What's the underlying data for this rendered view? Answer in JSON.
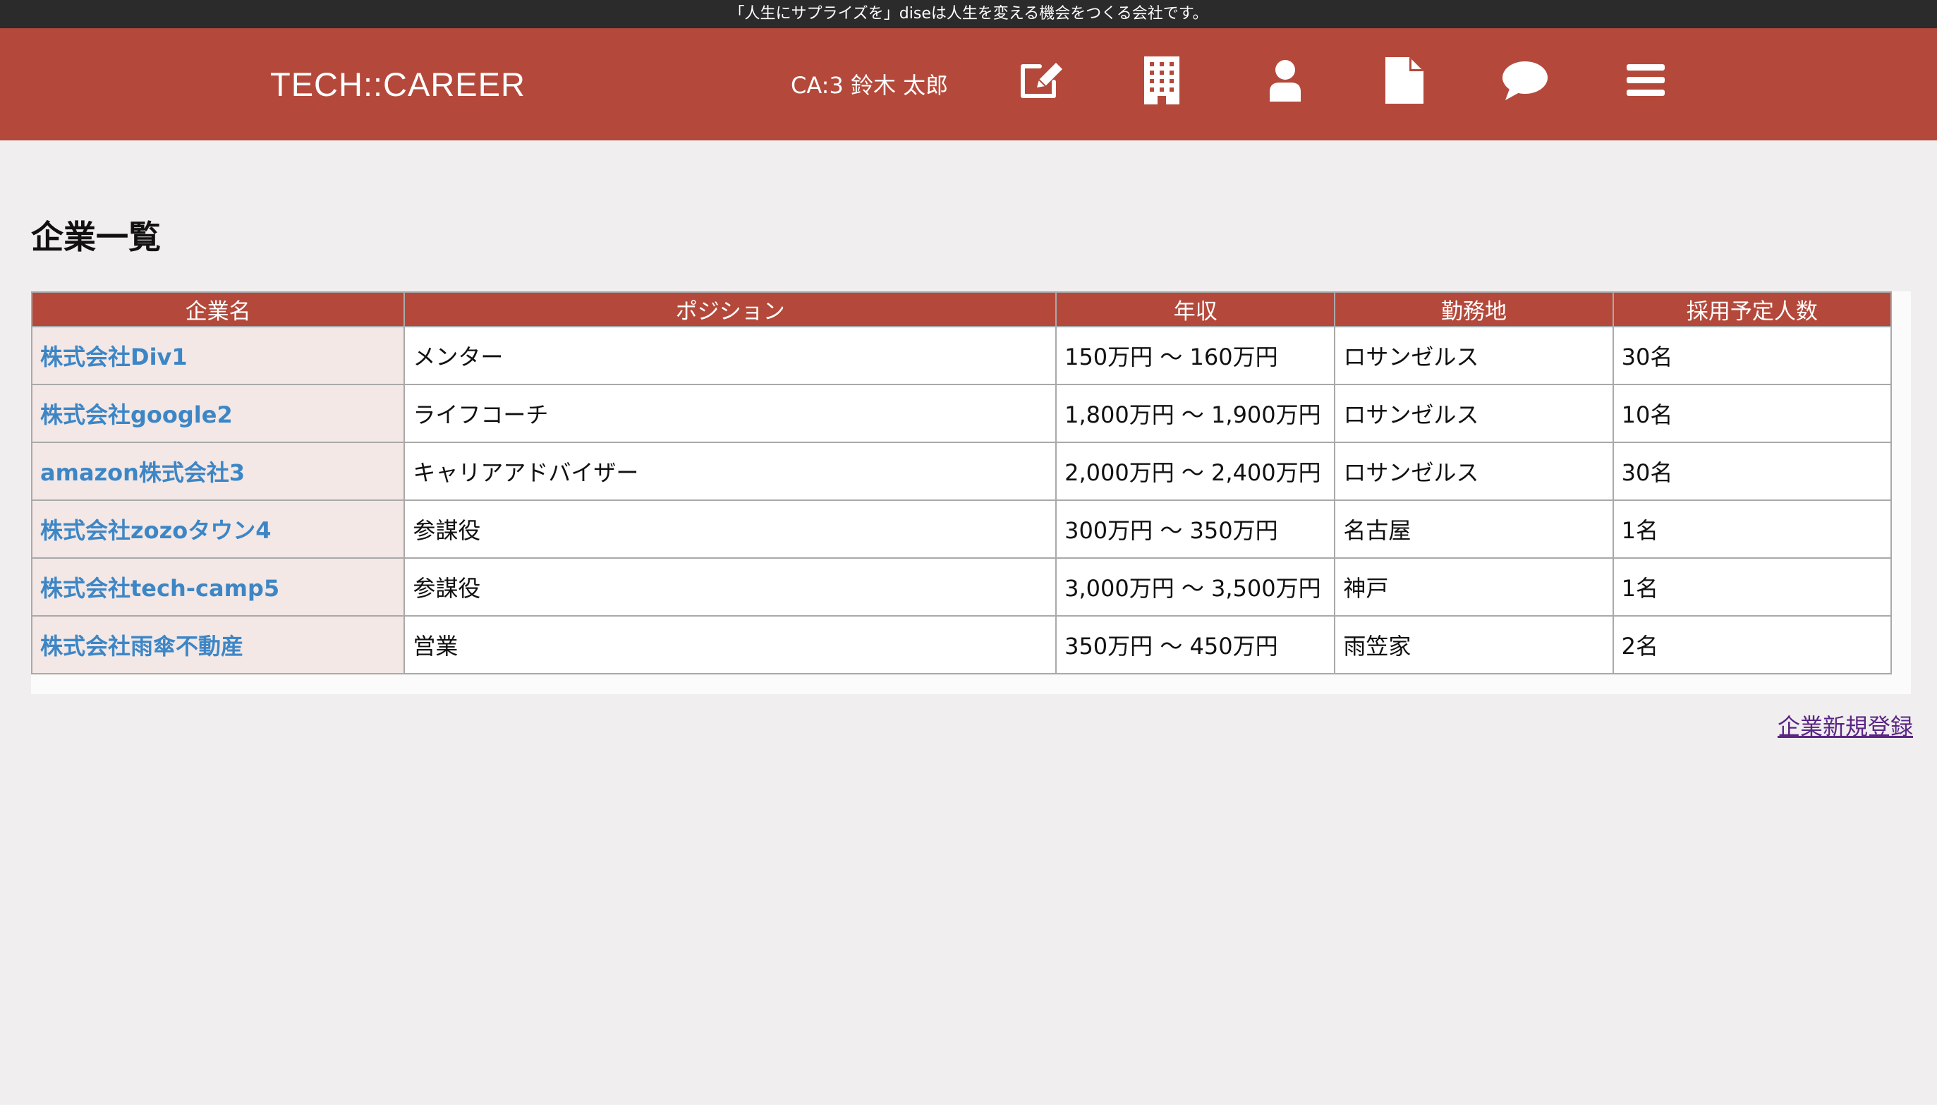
{
  "topbar": {
    "message": "「人生にサプライズを」diseは人生を変える機会をつくる会社です。"
  },
  "header": {
    "logo": "TECH::CAREER",
    "user": "CA:3 鈴木 太郎",
    "nav_icons": [
      "edit-icon",
      "building-icon",
      "user-icon",
      "document-icon",
      "chat-icon",
      "menu-icon"
    ]
  },
  "page": {
    "title": "企業一覧"
  },
  "table": {
    "headers": [
      "企業名",
      "ポジション",
      "年収",
      "勤務地",
      "採用予定人数"
    ],
    "rows": [
      {
        "company": "株式会社Div1",
        "position": "メンター",
        "salary": "150万円 〜 160万円",
        "location": "ロサンゼルス",
        "count": "30名"
      },
      {
        "company": "株式会社google2",
        "position": "ライフコーチ",
        "salary": "1,800万円 〜 1,900万円",
        "location": "ロサンゼルス",
        "count": "10名"
      },
      {
        "company": "amazon株式会社3",
        "position": "キャリアアドバイザー",
        "salary": "2,000万円 〜 2,400万円",
        "location": "ロサンゼルス",
        "count": "30名"
      },
      {
        "company": "株式会社zozoタウン4",
        "position": "参謀役",
        "salary": "300万円 〜 350万円",
        "location": "名古屋",
        "count": "1名"
      },
      {
        "company": "株式会社tech-camp5",
        "position": "参謀役",
        "salary": "3,000万円 〜 3,500万円",
        "location": "神戸",
        "count": "1名"
      },
      {
        "company": "株式会社雨傘不動産",
        "position": "営業",
        "salary": "350万円 〜 450万円",
        "location": "雨笠家",
        "count": "2名"
      }
    ]
  },
  "actions": {
    "new_company": "企業新規登録"
  },
  "colors": {
    "brand": "#b4493b",
    "topbar": "#2b2b2b",
    "link": "#3d86c6",
    "visited_link": "#5a2585",
    "company_cell": "#f3e8e6"
  }
}
